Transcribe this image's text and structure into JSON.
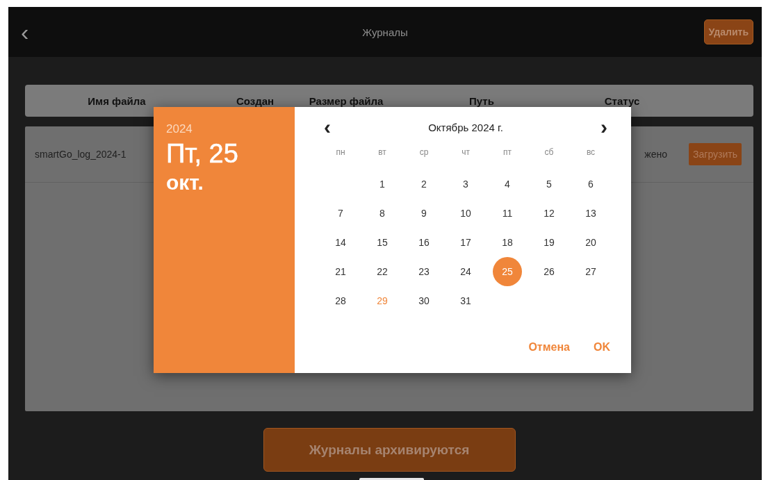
{
  "header": {
    "back": "‹",
    "title": "Журналы",
    "delete_button": "Удалить"
  },
  "table": {
    "columns": [
      "Имя файла",
      "Создан",
      "Размер файла",
      "Путь",
      "Статус"
    ],
    "rows": [
      {
        "file_name": "smartGo_log_2024-1",
        "status": "жено",
        "action": "Загрузить"
      }
    ]
  },
  "archive_button": "Журналы архивируются",
  "date_picker": {
    "year": "2024",
    "date_line": "Пт, 25",
    "month_line": "окт.",
    "prev": "‹",
    "next": "›",
    "month_title": "Октябрь 2024 г.",
    "weekdays": [
      "пн",
      "вт",
      "ср",
      "чт",
      "пт",
      "сб",
      "вс"
    ],
    "weeks": [
      [
        {
          "label": "1",
          "selected": false,
          "today": false
        },
        {
          "label": "2",
          "selected": false,
          "today": false
        },
        {
          "label": "3",
          "selected": false,
          "today": false
        },
        {
          "label": "4",
          "selected": false,
          "today": false
        },
        {
          "label": "5",
          "selected": false,
          "today": false
        },
        {
          "label": "6",
          "selected": false,
          "today": false
        }
      ],
      [
        {
          "label": "7",
          "selected": false,
          "today": false
        },
        {
          "label": "8",
          "selected": false,
          "today": false
        },
        {
          "label": "9",
          "selected": false,
          "today": false
        },
        {
          "label": "10",
          "selected": false,
          "today": false
        },
        {
          "label": "11",
          "selected": false,
          "today": false
        },
        {
          "label": "12",
          "selected": false,
          "today": false
        },
        {
          "label": "13",
          "selected": false,
          "today": false
        }
      ],
      [
        {
          "label": "14",
          "selected": false,
          "today": false
        },
        {
          "label": "15",
          "selected": false,
          "today": false
        },
        {
          "label": "16",
          "selected": false,
          "today": false
        },
        {
          "label": "17",
          "selected": false,
          "today": false
        },
        {
          "label": "18",
          "selected": false,
          "today": false
        },
        {
          "label": "19",
          "selected": false,
          "today": false
        },
        {
          "label": "20",
          "selected": false,
          "today": false
        }
      ],
      [
        {
          "label": "21",
          "selected": false,
          "today": false
        },
        {
          "label": "22",
          "selected": false,
          "today": false
        },
        {
          "label": "23",
          "selected": false,
          "today": false
        },
        {
          "label": "24",
          "selected": false,
          "today": false
        },
        {
          "label": "25",
          "selected": true,
          "today": false
        },
        {
          "label": "26",
          "selected": false,
          "today": false
        },
        {
          "label": "27",
          "selected": false,
          "today": false
        }
      ],
      [
        {
          "label": "28",
          "selected": false,
          "today": false
        },
        {
          "label": "29",
          "selected": false,
          "today": true
        },
        {
          "label": "30",
          "selected": false,
          "today": false
        },
        {
          "label": "31",
          "selected": false,
          "today": false
        }
      ]
    ],
    "cancel": "Отмена",
    "ok": "OK"
  }
}
